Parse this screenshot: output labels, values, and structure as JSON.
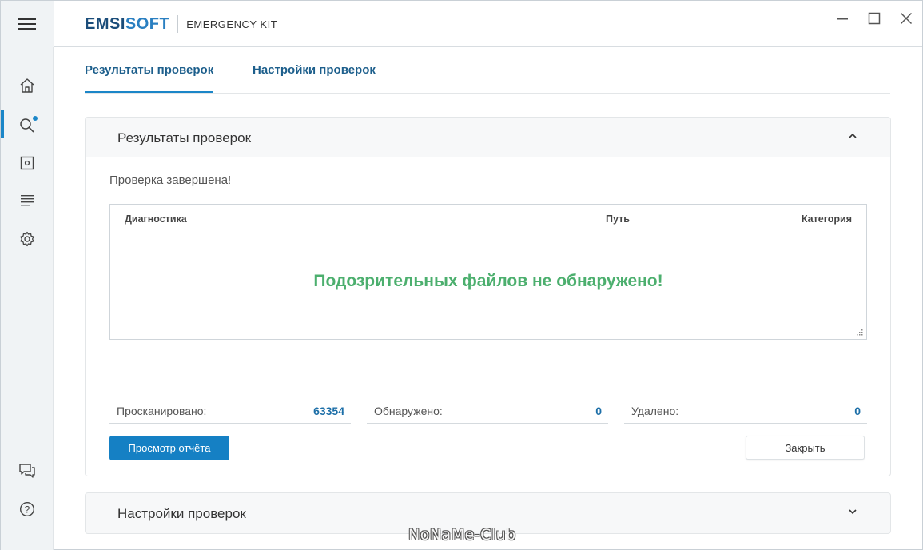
{
  "app": {
    "brand": "EMSISOFT",
    "brand_part1": "EMSI",
    "brand_part2": "SOFT",
    "product": "EMERGENCY KIT"
  },
  "sidebar": {
    "items": [
      {
        "icon": "home-icon"
      },
      {
        "icon": "search-icon",
        "active": true,
        "badge": true
      },
      {
        "icon": "quarantine-icon"
      },
      {
        "icon": "logs-icon"
      },
      {
        "icon": "gear-icon"
      },
      {
        "icon": "feedback-icon"
      },
      {
        "icon": "help-icon"
      }
    ]
  },
  "tabs": [
    {
      "label": "Результаты проверок",
      "active": true
    },
    {
      "label": "Настройки проверок",
      "active": false
    }
  ],
  "results_panel": {
    "title": "Результаты проверок",
    "status": "Проверка завершена!",
    "columns": [
      "Диагностика",
      "Путь",
      "Категория"
    ],
    "empty_message": "Подозрительных файлов не обнаружено!",
    "stats": [
      {
        "label": "Просканировано:",
        "value": "63354"
      },
      {
        "label": "Обнаружено:",
        "value": "0"
      },
      {
        "label": "Удалено:",
        "value": "0"
      }
    ],
    "view_report_label": "Просмотр отчёта",
    "close_label": "Закрыть"
  },
  "settings_panel": {
    "title": "Настройки проверок"
  },
  "watermark": "NoNaMe-Club",
  "colors": {
    "accent": "#1b86c8",
    "primary_button": "#1580c4",
    "success_text": "#4caf6e",
    "brand_dark": "#1b4d7a"
  }
}
